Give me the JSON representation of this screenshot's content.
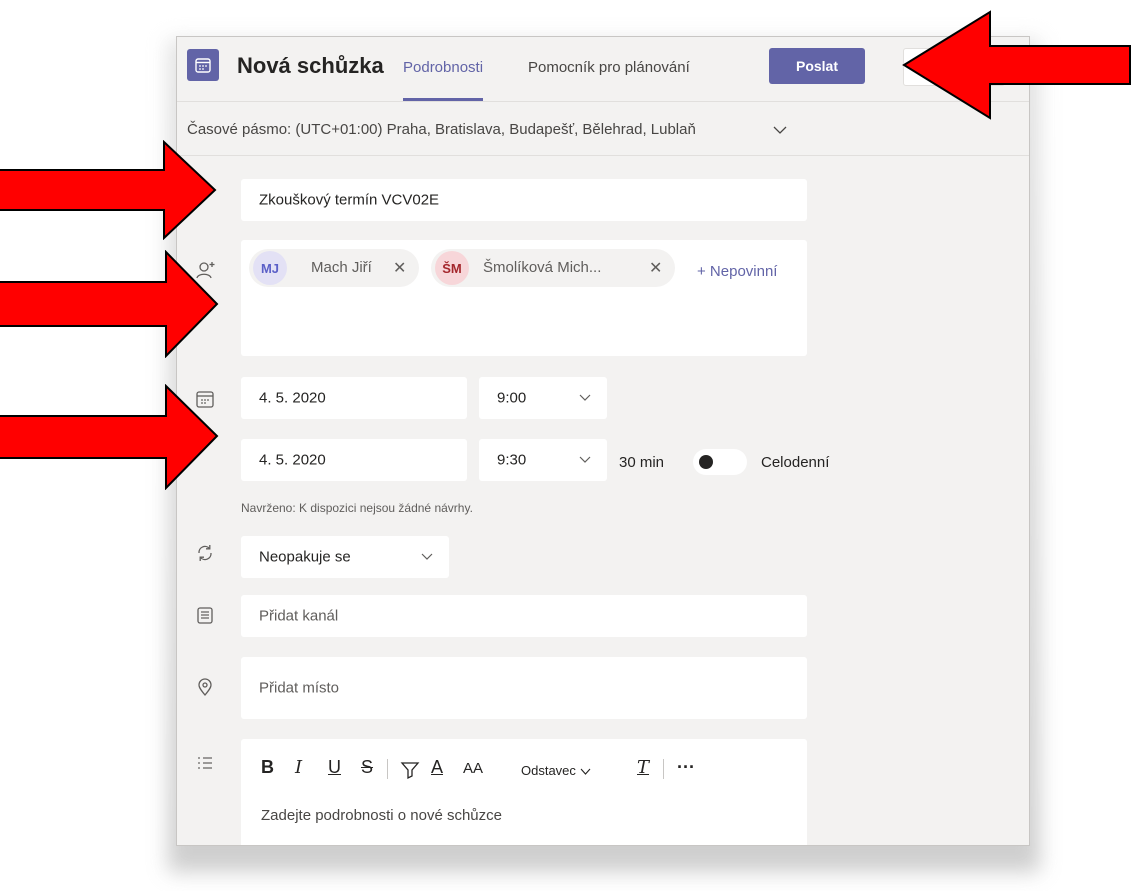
{
  "header": {
    "title": "Nová schůzka",
    "tabs": [
      {
        "label": "Podrobnosti",
        "active": true
      },
      {
        "label": "Pomocník pro plánování",
        "active": false
      }
    ],
    "send_label": "Poslat",
    "app_icon": "calendar-icon"
  },
  "timezone": {
    "label": "Časové pásmo: (UTC+01:00) Praha, Bratislava, Budapešť, Bělehrad, Lublaň"
  },
  "form": {
    "title_value": "Zkouškový termín VCV02E",
    "attendees": [
      {
        "initials": "MJ",
        "name": "Mach Jiří",
        "color": "#e3e1f5",
        "text_color": "#5b5fc7"
      },
      {
        "initials": "ŠM",
        "name": "Šmolíková Mich...",
        "color": "#f7d6d9",
        "text_color": "#a4262c"
      }
    ],
    "optional_link": "+ Nepovinní",
    "start_date": "4. 5. 2020",
    "start_time": "9:00",
    "end_date": "4. 5. 2020",
    "end_time": "9:30",
    "duration": "30 min",
    "all_day_label": "Celodenní",
    "suggestion": "Navrženo: K dispozici nejsou žádné návrhy.",
    "repeat": "Neopakuje se",
    "channel_placeholder": "Přidat kanál",
    "location_placeholder": "Přidat místo",
    "editor": {
      "bold": "B",
      "italic": "I",
      "underline": "U",
      "strike": "S",
      "font_color": "A",
      "font_size": "AA",
      "paragraph": "Odstavec",
      "clear_format": "T",
      "more": "···",
      "placeholder": "Zadejte podrobnosti o nové schůzce"
    }
  },
  "colors": {
    "accent": "#6264a7",
    "arrow": "#ff0000"
  }
}
